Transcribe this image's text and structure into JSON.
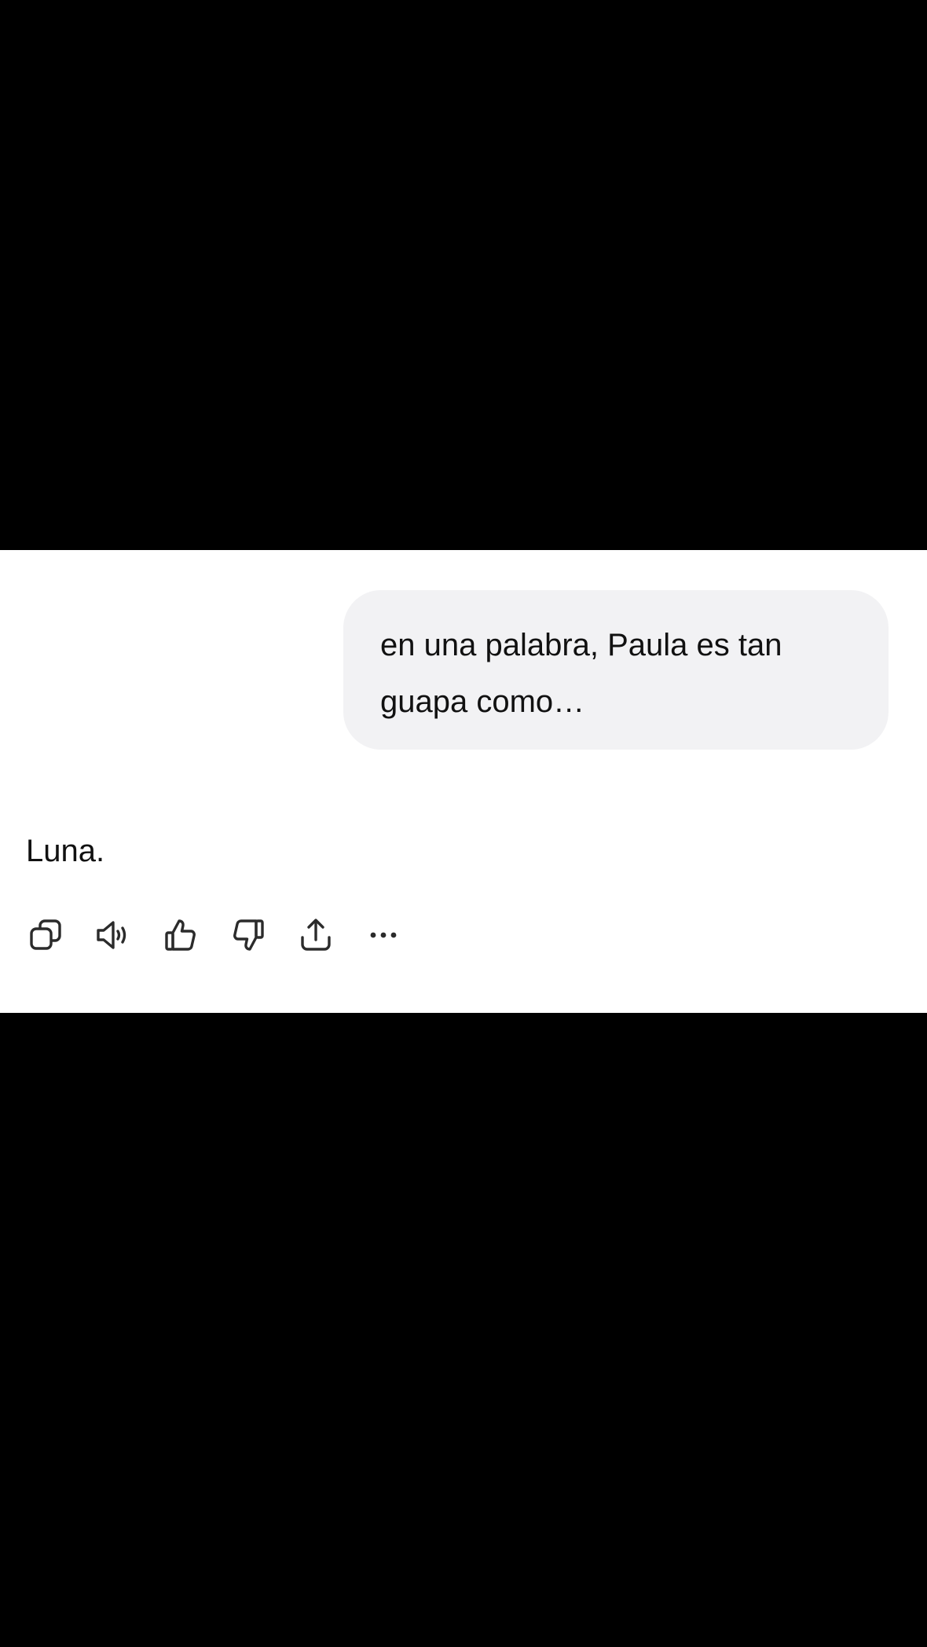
{
  "conversation": {
    "user_message": "en una palabra, Paula es tan\nguapa como…",
    "assistant_message": "Luna."
  },
  "actions": [
    {
      "name": "copy-button",
      "icon": "copy-icon"
    },
    {
      "name": "read-aloud-button",
      "icon": "speaker-icon"
    },
    {
      "name": "thumbs-up-button",
      "icon": "thumbs-up-icon"
    },
    {
      "name": "thumbs-down-button",
      "icon": "thumbs-down-icon"
    },
    {
      "name": "share-button",
      "icon": "share-icon"
    },
    {
      "name": "more-options-button",
      "icon": "ellipsis-icon"
    }
  ],
  "colors": {
    "background": "#ffffff",
    "user_bubble": "#f2f2f4",
    "text": "#111111",
    "icon": "#2b2b2b",
    "letterbox": "#000000"
  }
}
